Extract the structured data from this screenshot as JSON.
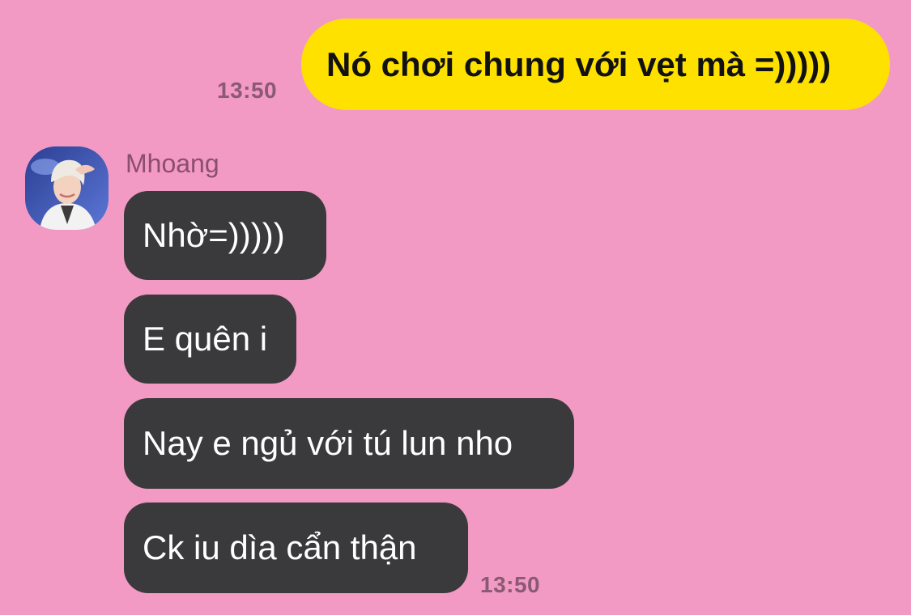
{
  "chat": {
    "background_color": "#f39ac4",
    "outgoing": {
      "text": "Nó chơi chung với vẹt mà =)))))",
      "time": "13:50",
      "bubble_color": "#ffe100"
    },
    "incoming": {
      "sender_name": "Mhoang",
      "avatar_icon": "user-avatar-photo",
      "bubble_color": "#3a3a3c",
      "messages": [
        {
          "text": "Nhờ=)))))"
        },
        {
          "text": "E quên i"
        },
        {
          "text": "Nay e ngủ với tú lun nho"
        },
        {
          "text": "Ck iu dìa cẩn thận"
        }
      ],
      "time": "13:50"
    }
  }
}
